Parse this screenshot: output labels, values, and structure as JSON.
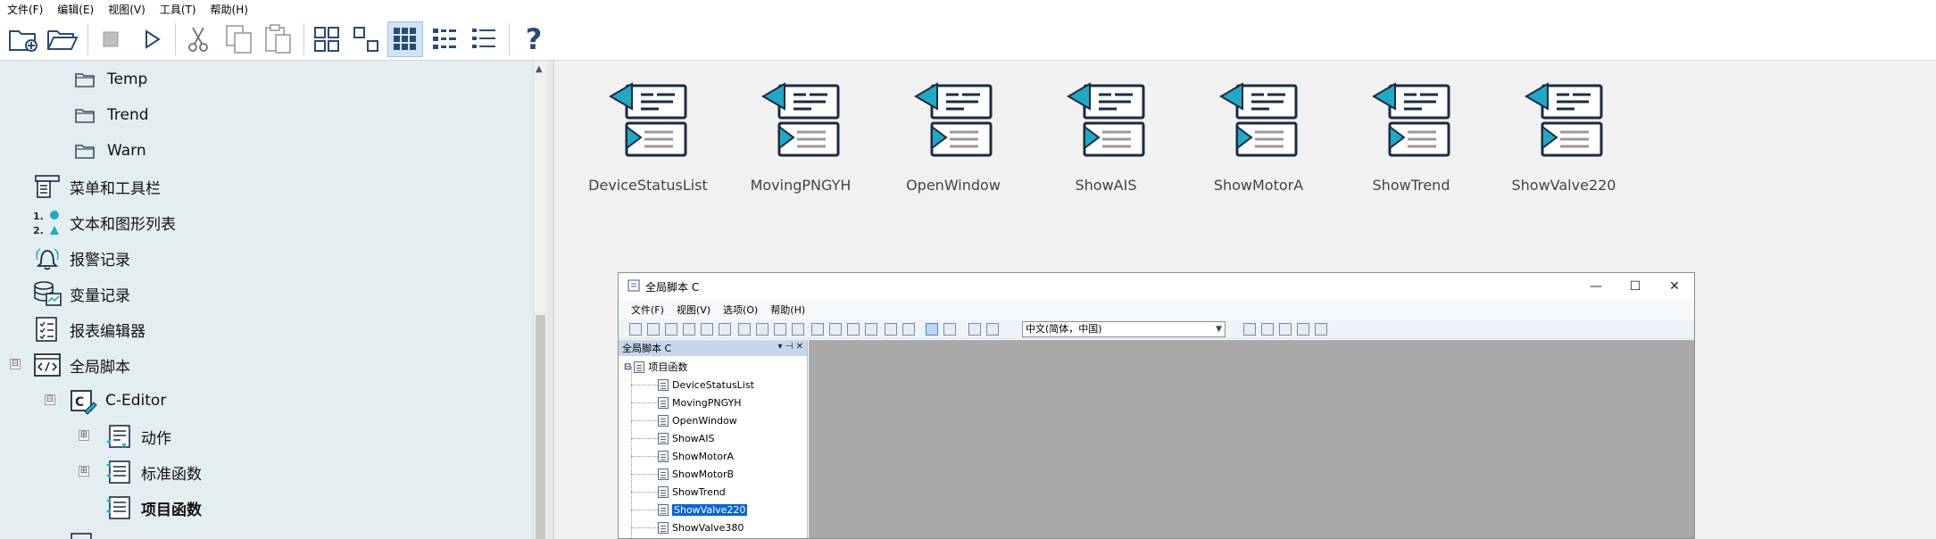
{
  "menubar": {
    "items": [
      "文件(F)",
      "编辑(E)",
      "视图(V)",
      "工具(T)",
      "帮助(H)"
    ]
  },
  "toolbar": {
    "buttons": [
      "new-project-icon",
      "open-project-icon",
      "stop-icon",
      "run-icon",
      "cut-icon",
      "copy-icon",
      "paste-icon",
      "large-icons-view-icon",
      "small-icons-view-icon",
      "grid-view-icon",
      "detail-view-icon",
      "list-view-icon",
      "help-icon"
    ],
    "active_view": "grid-view-icon"
  },
  "tree": {
    "items": [
      {
        "label": "Temp",
        "icon": "folder-icon"
      },
      {
        "label": "Trend",
        "icon": "folder-icon"
      },
      {
        "label": "Warn",
        "icon": "folder-icon"
      },
      {
        "label": "菜单和工具栏",
        "icon": "menu-toolbar-icon"
      },
      {
        "label": "文本和图形列表",
        "icon": "text-graphic-list-icon"
      },
      {
        "label": "报警记录",
        "icon": "alarm-bell-icon"
      },
      {
        "label": "变量记录",
        "icon": "tag-logging-icon"
      },
      {
        "label": "报表编辑器",
        "icon": "report-editor-icon"
      },
      {
        "label": "全局脚本",
        "icon": "global-script-icon",
        "expander": "⊟"
      },
      {
        "label": "C-Editor",
        "icon": "c-editor-icon",
        "expander": "⊟"
      },
      {
        "label": "动作",
        "icon": "action-icon",
        "expander": "⊞"
      },
      {
        "label": "标准函数",
        "icon": "function-icon",
        "expander": "⊞"
      },
      {
        "label": "项目函数",
        "icon": "function-icon",
        "bold": true
      }
    ]
  },
  "files": {
    "items": [
      "DeviceStatusList",
      "MovingPNGYH",
      "OpenWindow",
      "ShowAIS",
      "ShowMotorA",
      "ShowTrend",
      "ShowValve220"
    ]
  },
  "window": {
    "title": "全局脚本 C",
    "minimize": "—",
    "maximize": "☐",
    "close": "✕",
    "menu": [
      "文件(F)",
      "视图(V)",
      "选项(O)",
      "帮助(H)"
    ],
    "language": "中文(简体，中国)",
    "pane_title": "全局脚本 C",
    "pane_pin": "▾ ⊣ ✕",
    "tree_root": "项目函数",
    "tree_items": [
      "DeviceStatusList",
      "MovingPNGYH",
      "OpenWindow",
      "ShowAIS",
      "ShowMotorA",
      "ShowMotorB",
      "ShowTrend",
      "ShowValve220",
      "ShowValve380"
    ],
    "selected": "ShowValve220"
  },
  "colors": {
    "accent": "#0a64d6",
    "icon_cyan": "#21a8c4",
    "tree_bg": "#e3eef0"
  }
}
